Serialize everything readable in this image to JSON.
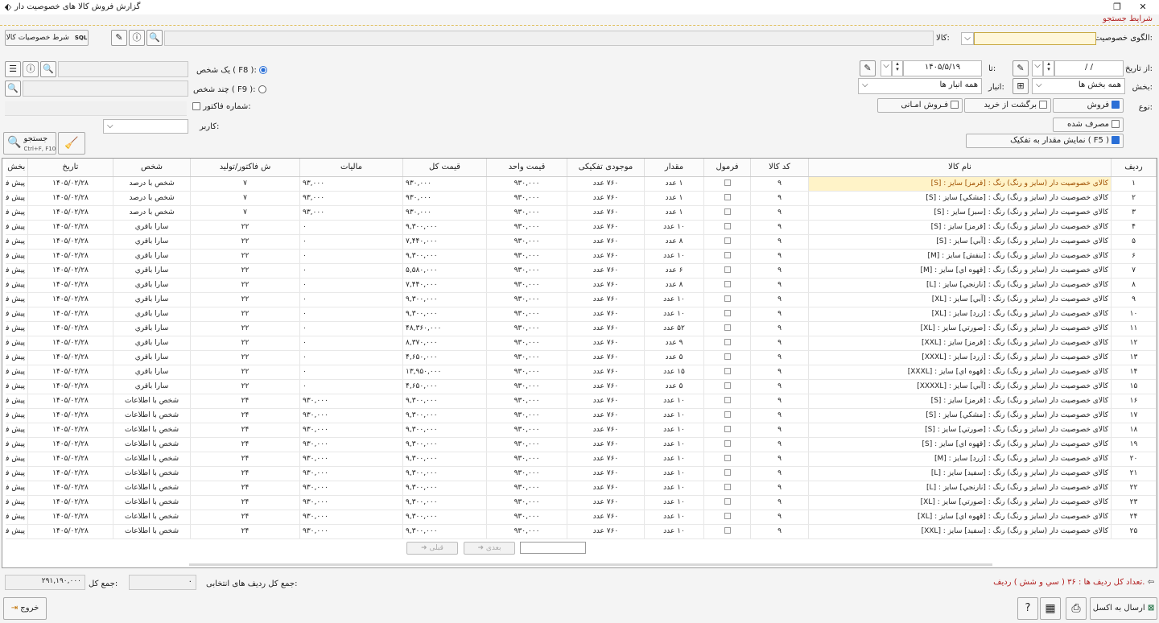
{
  "window": {
    "title": "گزارش فروش کالا های خصوصیت دار"
  },
  "search": {
    "section_title": "شرايط جستجو",
    "pattern_label": "الگوی خصوصیت:",
    "item_label": "كالا:",
    "item_feature_btn": "شرط خصوصیات کالا",
    "sql_badge": "SQL",
    "from_date_label": "از تاریخ:",
    "from_date_value": "/ /",
    "to_date_label": "تا:",
    "to_date_value": "۱۴۰۵/۵/۱۹",
    "section_label": "بخش:",
    "section_value": "همه بخش ها",
    "warehouse_label": "انبار:",
    "warehouse_value": "همه انبار ها",
    "type_label": "نوع:",
    "type_sale": "فروش",
    "type_return": "برگشت از خريد",
    "type_trust": "فـروش امـانی",
    "consumed": "مصرف شده",
    "show_breakdown": "نمایش مقدار به تفکیک ( F5 )",
    "one_person": "یک شخص ( F8 ):",
    "multi_person": "چند شخص ( F9 ):",
    "invoice_no": "شماره فاكتور:",
    "user_label": "کاربر:",
    "search_btn": "جستجو",
    "search_shortcut": "Ctrl+F, F10"
  },
  "table": {
    "columns": [
      "رديف",
      "نام كالا",
      "کد كالا",
      "فرمول",
      "مقدار",
      "موجودی تفکیکی",
      "قیمت واحد",
      "قيمت كل",
      "ماليات",
      "ش فاكتور/توليد",
      "شخص",
      "تاريخ",
      "بخش"
    ],
    "rows": [
      [
        "۱",
        "کالای خصوصیت دار (سایز و رنگ) رنگ : [قرمز] سایز : [S]",
        "۹",
        "",
        "۱ عدد",
        "۷۶۰ عدد",
        "۹۳۰,۰۰۰",
        "۹۳۰,۰۰۰",
        "۹۳,۰۰۰",
        "۷",
        "شخص با درصد",
        "۱۴۰۵/۰۲/۲۸",
        "پیش فرض"
      ],
      [
        "۲",
        "کالای خصوصیت دار (سایز و رنگ) رنگ : [مشکي] سایز : [S]",
        "۹",
        "",
        "۱ عدد",
        "۷۶۰ عدد",
        "۹۳۰,۰۰۰",
        "۹۳۰,۰۰۰",
        "۹۳,۰۰۰",
        "۷",
        "شخص با درصد",
        "۱۴۰۵/۰۲/۲۸",
        "پیش فرض"
      ],
      [
        "۳",
        "کالای خصوصیت دار (سایز و رنگ) رنگ : [سبز] سایز : [S]",
        "۹",
        "",
        "۱ عدد",
        "۷۶۰ عدد",
        "۹۳۰,۰۰۰",
        "۹۳۰,۰۰۰",
        "۹۳,۰۰۰",
        "۷",
        "شخص با درصد",
        "۱۴۰۵/۰۲/۲۸",
        "پیش فرض"
      ],
      [
        "۴",
        "کالای خصوصیت دار (سایز و رنگ) رنگ : [قرمز] سایز : [S]",
        "۹",
        "",
        "۱۰ عدد",
        "۷۶۰ عدد",
        "۹۳۰,۰۰۰",
        "۹,۳۰۰,۰۰۰",
        "۰",
        "۲۲",
        "سارا باقري",
        "۱۴۰۵/۰۲/۲۸",
        "پیش فرض"
      ],
      [
        "۵",
        "کالای خصوصیت دار (سایز و رنگ) رنگ : [آبي] سایز : [S]",
        "۹",
        "",
        "۸ عدد",
        "۷۶۰ عدد",
        "۹۳۰,۰۰۰",
        "۷,۴۴۰,۰۰۰",
        "۰",
        "۲۲",
        "سارا باقري",
        "۱۴۰۵/۰۲/۲۸",
        "پیش فرض"
      ],
      [
        "۶",
        "کالای خصوصیت دار (سایز و رنگ) رنگ : [بنفش] سایز : [M]",
        "۹",
        "",
        "۱۰ عدد",
        "۷۶۰ عدد",
        "۹۳۰,۰۰۰",
        "۹,۳۰۰,۰۰۰",
        "۰",
        "۲۲",
        "سارا باقري",
        "۱۴۰۵/۰۲/۲۸",
        "پیش فرض"
      ],
      [
        "۷",
        "کالای خصوصیت دار (سایز و رنگ) رنگ : [قهوه اي] سایز : [M]",
        "۹",
        "",
        "۶ عدد",
        "۷۶۰ عدد",
        "۹۳۰,۰۰۰",
        "۵,۵۸۰,۰۰۰",
        "۰",
        "۲۲",
        "سارا باقري",
        "۱۴۰۵/۰۲/۲۸",
        "پیش فرض"
      ],
      [
        "۸",
        "کالای خصوصیت دار (سایز و رنگ) رنگ : [نارنجي] سایز : [L]",
        "۹",
        "",
        "۸ عدد",
        "۷۶۰ عدد",
        "۹۳۰,۰۰۰",
        "۷,۴۴۰,۰۰۰",
        "۰",
        "۲۲",
        "سارا باقري",
        "۱۴۰۵/۰۲/۲۸",
        "پیش فرض"
      ],
      [
        "۹",
        "کالای خصوصیت دار (سایز و رنگ) رنگ : [آبي] سایز : [XL]",
        "۹",
        "",
        "۱۰ عدد",
        "۷۶۰ عدد",
        "۹۳۰,۰۰۰",
        "۹,۳۰۰,۰۰۰",
        "۰",
        "۲۲",
        "سارا باقري",
        "۱۴۰۵/۰۲/۲۸",
        "پیش فرض"
      ],
      [
        "۱۰",
        "کالای خصوصیت دار (سایز و رنگ) رنگ : [زرد] سایز : [XL]",
        "۹",
        "",
        "۱۰ عدد",
        "۷۶۰ عدد",
        "۹۳۰,۰۰۰",
        "۹,۳۰۰,۰۰۰",
        "۰",
        "۲۲",
        "سارا باقري",
        "۱۴۰۵/۰۲/۲۸",
        "پیش فرض"
      ],
      [
        "۱۱",
        "کالای خصوصیت دار (سایز و رنگ) رنگ : [صورتي] سایز : [XL]",
        "۹",
        "",
        "۵۲ عدد",
        "۷۶۰ عدد",
        "۹۳۰,۰۰۰",
        "۴۸,۳۶۰,۰۰۰",
        "۰",
        "۲۲",
        "سارا باقري",
        "۱۴۰۵/۰۲/۲۸",
        "پیش فرض"
      ],
      [
        "۱۲",
        "کالای خصوصیت دار (سایز و رنگ) رنگ : [قرمز] سایز : [XXL]",
        "۹",
        "",
        "۹ عدد",
        "۷۶۰ عدد",
        "۹۳۰,۰۰۰",
        "۸,۳۷۰,۰۰۰",
        "۰",
        "۲۲",
        "سارا باقري",
        "۱۴۰۵/۰۲/۲۸",
        "پیش فرض"
      ],
      [
        "۱۳",
        "کالای خصوصیت دار (سایز و رنگ) رنگ : [زرد] سایز : [XXXL]",
        "۹",
        "",
        "۵ عدد",
        "۷۶۰ عدد",
        "۹۳۰,۰۰۰",
        "۴,۶۵۰,۰۰۰",
        "۰",
        "۲۲",
        "سارا باقري",
        "۱۴۰۵/۰۲/۲۸",
        "پیش فرض"
      ],
      [
        "۱۴",
        "کالای خصوصیت دار (سایز و رنگ) رنگ : [قهوه اي] سایز : [XXXL]",
        "۹",
        "",
        "۱۵ عدد",
        "۷۶۰ عدد",
        "۹۳۰,۰۰۰",
        "۱۳,۹۵۰,۰۰۰",
        "۰",
        "۲۲",
        "سارا باقري",
        "۱۴۰۵/۰۲/۲۸",
        "پیش فرض"
      ],
      [
        "۱۵",
        "کالای خصوصیت دار (سایز و رنگ) رنگ : [آبي] سایز : [XXXXL]",
        "۹",
        "",
        "۵ عدد",
        "۷۶۰ عدد",
        "۹۳۰,۰۰۰",
        "۴,۶۵۰,۰۰۰",
        "۰",
        "۲۲",
        "سارا باقري",
        "۱۴۰۵/۰۲/۲۸",
        "پیش فرض"
      ],
      [
        "۱۶",
        "کالای خصوصیت دار (سایز و رنگ) رنگ : [قرمز] سایز : [S]",
        "۹",
        "",
        "۱۰ عدد",
        "۷۶۰ عدد",
        "۹۳۰,۰۰۰",
        "۹,۳۰۰,۰۰۰",
        "۹۳۰,۰۰۰",
        "۲۴",
        "شخص با اطلاعات",
        "۱۴۰۵/۰۲/۲۸",
        "پیش فرض"
      ],
      [
        "۱۷",
        "کالای خصوصیت دار (سایز و رنگ) رنگ : [مشکي] سایز : [S]",
        "۹",
        "",
        "۱۰ عدد",
        "۷۶۰ عدد",
        "۹۳۰,۰۰۰",
        "۹,۳۰۰,۰۰۰",
        "۹۳۰,۰۰۰",
        "۲۴",
        "شخص با اطلاعات",
        "۱۴۰۵/۰۲/۲۸",
        "پیش فرض"
      ],
      [
        "۱۸",
        "کالای خصوصیت دار (سایز و رنگ) رنگ : [صورتي] سایز : [S]",
        "۹",
        "",
        "۱۰ عدد",
        "۷۶۰ عدد",
        "۹۳۰,۰۰۰",
        "۹,۳۰۰,۰۰۰",
        "۹۳۰,۰۰۰",
        "۲۴",
        "شخص با اطلاعات",
        "۱۴۰۵/۰۲/۲۸",
        "پیش فرض"
      ],
      [
        "۱۹",
        "کالای خصوصیت دار (سایز و رنگ) رنگ : [قهوه اي] سایز : [S]",
        "۹",
        "",
        "۱۰ عدد",
        "۷۶۰ عدد",
        "۹۳۰,۰۰۰",
        "۹,۳۰۰,۰۰۰",
        "۹۳۰,۰۰۰",
        "۲۴",
        "شخص با اطلاعات",
        "۱۴۰۵/۰۲/۲۸",
        "پیش فرض"
      ],
      [
        "۲۰",
        "کالای خصوصیت دار (سایز و رنگ) رنگ : [زرد] سایز : [M]",
        "۹",
        "",
        "۱۰ عدد",
        "۷۶۰ عدد",
        "۹۳۰,۰۰۰",
        "۹,۳۰۰,۰۰۰",
        "۹۳۰,۰۰۰",
        "۲۴",
        "شخص با اطلاعات",
        "۱۴۰۵/۰۲/۲۸",
        "پیش فرض"
      ],
      [
        "۲۱",
        "کالای خصوصیت دار (سایز و رنگ) رنگ : [سفيد] سایز : [L]",
        "۹",
        "",
        "۱۰ عدد",
        "۷۶۰ عدد",
        "۹۳۰,۰۰۰",
        "۹,۳۰۰,۰۰۰",
        "۹۳۰,۰۰۰",
        "۲۴",
        "شخص با اطلاعات",
        "۱۴۰۵/۰۲/۲۸",
        "پیش فرض"
      ],
      [
        "۲۲",
        "کالای خصوصیت دار (سایز و رنگ) رنگ : [نارنجي] سایز : [L]",
        "۹",
        "",
        "۱۰ عدد",
        "۷۶۰ عدد",
        "۹۳۰,۰۰۰",
        "۹,۳۰۰,۰۰۰",
        "۹۳۰,۰۰۰",
        "۲۴",
        "شخص با اطلاعات",
        "۱۴۰۵/۰۲/۲۸",
        "پیش فرض"
      ],
      [
        "۲۳",
        "کالای خصوصیت دار (سایز و رنگ) رنگ : [صورتي] سایز : [XL]",
        "۹",
        "",
        "۱۰ عدد",
        "۷۶۰ عدد",
        "۹۳۰,۰۰۰",
        "۹,۳۰۰,۰۰۰",
        "۹۳۰,۰۰۰",
        "۲۴",
        "شخص با اطلاعات",
        "۱۴۰۵/۰۲/۲۸",
        "پیش فرض"
      ],
      [
        "۲۴",
        "کالای خصوصیت دار (سایز و رنگ) رنگ : [قهوه اي] سایز : [XL]",
        "۹",
        "",
        "۱۰ عدد",
        "۷۶۰ عدد",
        "۹۳۰,۰۰۰",
        "۹,۳۰۰,۰۰۰",
        "۹۳۰,۰۰۰",
        "۲۴",
        "شخص با اطلاعات",
        "۱۴۰۵/۰۲/۲۸",
        "پیش فرض"
      ],
      [
        "۲۵",
        "کالای خصوصیت دار (سایز و رنگ) رنگ : [سفيد] سایز : [XXL]",
        "۹",
        "",
        "۱۰ عدد",
        "۷۶۰ عدد",
        "۹۳۰,۰۰۰",
        "۹,۳۰۰,۰۰۰",
        "۹۳۰,۰۰۰",
        "۲۴",
        "شخص با اطلاعات",
        "۱۴۰۵/۰۲/۲۸",
        "پیش فرض"
      ]
    ]
  },
  "pager": {
    "prev": "قبلی",
    "next": "بعدی"
  },
  "footer": {
    "row_count": "تعداد کل ردیف ها : ۳۶ ( سي و شش ) رديف.",
    "selected_sum_label": "جمع کل ردیف های انتخابی:",
    "selected_sum_value": "۰",
    "total_label": "جمع کل:",
    "total_value": "۲۹۱,۱۹۰,۰۰۰",
    "excel_btn": "ارسال به اكسل",
    "exit_btn": "خروج"
  },
  "colors": {
    "accent": "#b22222",
    "selected_row": "#fff3c8",
    "check": "#2a6fd6"
  }
}
